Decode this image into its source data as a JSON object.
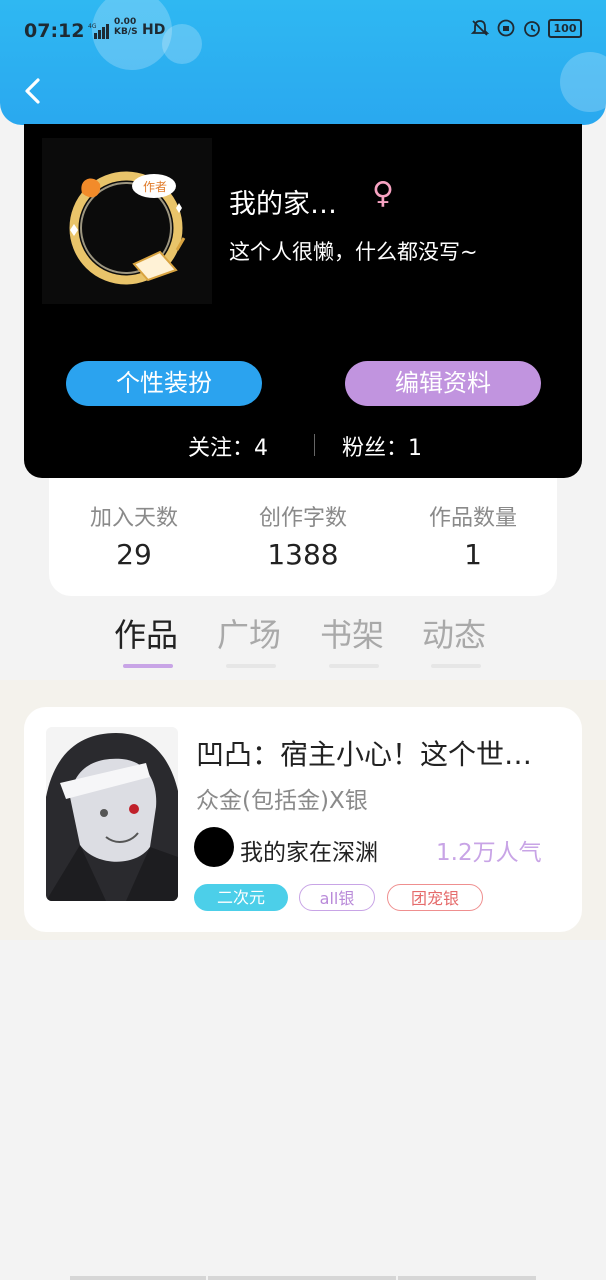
{
  "status_bar": {
    "time": "07:12",
    "network_type": "4G",
    "net_speed_value": "0.00",
    "net_speed_unit": "KB/S",
    "hd_label": "HD",
    "battery": "100"
  },
  "profile": {
    "nickname": "我的家…",
    "gender_symbol": "♀",
    "bio": "这个人很懒，什么都没写~",
    "avatar_frame_badge": "作者",
    "dress_up_button": "个性装扮",
    "edit_profile_button": "编辑资料",
    "following": "关注：4",
    "fans": "粉丝：1"
  },
  "stats": [
    {
      "label": "加入天数",
      "value": "29"
    },
    {
      "label": "创作字数",
      "value": "1388"
    },
    {
      "label": "作品数量",
      "value": "1"
    }
  ],
  "tabs": [
    {
      "label": "作品",
      "active": true
    },
    {
      "label": "广场",
      "active": false
    },
    {
      "label": "书架",
      "active": false
    },
    {
      "label": "动态",
      "active": false
    }
  ],
  "work": {
    "title": "凹凸：宿主小心！这个世…",
    "cp": "众金(包括金)X银",
    "author": "我的家在深渊",
    "popularity": "1.2万人气",
    "tags": [
      "二次元",
      "all银",
      "团宠银"
    ]
  },
  "colors": {
    "header": "#2aa8ef",
    "accent_blue": "#2ba3ef",
    "accent_purple": "#c194df",
    "popularity": "#c8a4e6"
  }
}
